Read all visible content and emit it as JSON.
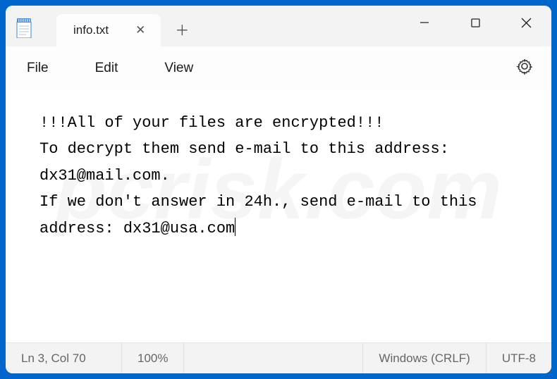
{
  "tab": {
    "title": "info.txt"
  },
  "menu": {
    "file": "File",
    "edit": "Edit",
    "view": "View"
  },
  "content": "!!!All of your files are encrypted!!!\nTo decrypt them send e-mail to this address: dx31@mail.com.\nIf we don't answer in 24h., send e-mail to this address: dx31@usa.com",
  "status": {
    "position": "Ln 3, Col 70",
    "zoom": "100%",
    "line_ending": "Windows (CRLF)",
    "encoding": "UTF-8"
  },
  "watermark": "pcrisk.com"
}
